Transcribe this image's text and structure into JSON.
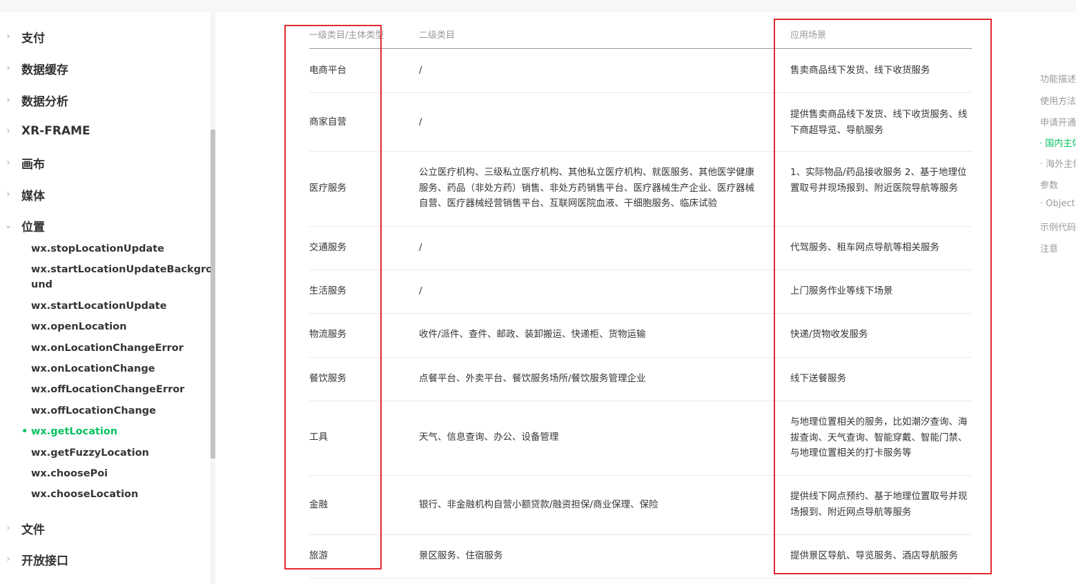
{
  "sidebar": {
    "sections_top": [
      {
        "label": "支付"
      },
      {
        "label": "数据缓存"
      },
      {
        "label": "数据分析"
      },
      {
        "label": "XR-FRAME"
      },
      {
        "label": "画布"
      },
      {
        "label": "媒体"
      }
    ],
    "expanded_section": {
      "label": "位置"
    },
    "location_items": [
      {
        "label": "wx.stopLocationUpdate"
      },
      {
        "label": "wx.startLocationUpdateBackgro und"
      },
      {
        "label": "wx.startLocationUpdate"
      },
      {
        "label": "wx.openLocation"
      },
      {
        "label": "wx.onLocationChangeError"
      },
      {
        "label": "wx.onLocationChange"
      },
      {
        "label": "wx.offLocationChangeError"
      },
      {
        "label": "wx.offLocationChange"
      },
      {
        "label": "wx.getLocation",
        "active": true
      },
      {
        "label": "wx.getFuzzyLocation"
      },
      {
        "label": "wx.choosePoi"
      },
      {
        "label": "wx.chooseLocation"
      }
    ],
    "sections_bottom": [
      {
        "label": "文件"
      },
      {
        "label": "开放接口"
      }
    ]
  },
  "table": {
    "headers": [
      "一级类目/主体类型",
      "二级类目",
      "应用场景"
    ],
    "rows": [
      {
        "c1": "电商平台",
        "c2": "/",
        "c3": "售卖商品线下发货、线下收货服务"
      },
      {
        "c1": "商家自营",
        "c2": "/",
        "c3": "提供售卖商品线下发货、线下收货服务、线下商超导览、导航服务"
      },
      {
        "c1": "医疗服务",
        "c2": "公立医疗机构、三级私立医疗机构、其他私立医疗机构、就医服务、其他医学健康服务、药品（非处方药）销售、非处方药销售平台、医疗器械生产企业、医疗器械自营、医疗器械经营销售平台、互联网医院血液、干细胞服务、临床试验",
        "c3": "1、实际物品/药品接收服务 2、基于地理位置取号并现场报到、附近医院导航等服务"
      },
      {
        "c1": "交通服务",
        "c2": "/",
        "c3": "代驾服务、租车网点导航等相关服务"
      },
      {
        "c1": "生活服务",
        "c2": "/",
        "c3": "上门服务作业等线下场景"
      },
      {
        "c1": "物流服务",
        "c2": "收件/派件、查件、邮政、装卸搬运、快递柜、货物运输",
        "c3": "快递/货物收发服务"
      },
      {
        "c1": "餐饮服务",
        "c2": "点餐平台、外卖平台、餐饮服务场所/餐饮服务管理企业",
        "c3": "线下送餐服务"
      },
      {
        "c1": "工具",
        "c2": "天气、信息查询、办公、设备管理",
        "c3": "与地理位置相关的服务，比如潮汐查询、海拔查询、天气查询、智能穿戴、智能门禁、与地理位置相关的打卡服务等"
      },
      {
        "c1": "金融",
        "c2": "银行、非金融机构自营小额贷款/融资担保/商业保理、保险",
        "c3": "提供线下网点预约、基于地理位置取号并现场报到、附近网点导航等服务"
      },
      {
        "c1": "旅游",
        "c2": "景区服务、住宿服务",
        "c3": "提供景区导航、导览服务、酒店导航服务"
      }
    ]
  },
  "toc": [
    {
      "label": "功能描述"
    },
    {
      "label": "使用方法"
    },
    {
      "label": "申请开通"
    },
    {
      "label": "· 国内主体",
      "active": true
    },
    {
      "label": "· 海外主体"
    },
    {
      "label": "参数"
    },
    {
      "label": "· Object"
    },
    {
      "label": "示例代码"
    },
    {
      "label": "注意"
    }
  ],
  "colors": {
    "accent": "#07c160",
    "highlight": "#e0282f"
  }
}
